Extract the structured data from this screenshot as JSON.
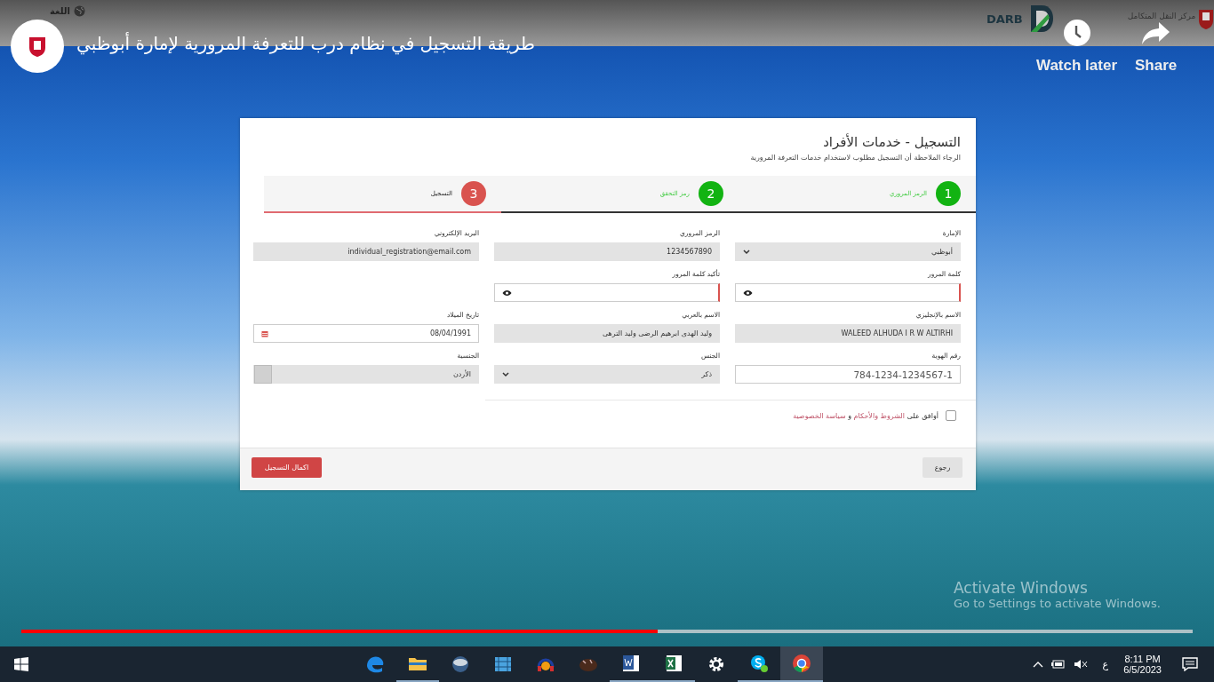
{
  "video": {
    "title": "طريقة التسجيل في نظام درب للتعرفة المرورية لإمارة أبوظبي",
    "language_label": "اللغة",
    "brand": {
      "latin": "DARB"
    },
    "emblem": {
      "arabic": "مركز النقل المتكامل"
    },
    "actions": [
      {
        "kind": "share",
        "label": "Share"
      },
      {
        "kind": "clock",
        "label": "Watch later"
      }
    ],
    "progress": {
      "level": 0.543
    },
    "os_notice": {
      "title": "Activate Windows",
      "subtitle": "Go to Settings to activate Windows."
    }
  },
  "form": {
    "title": "التسجيل - خدمات الأفراد",
    "subtitle": "الرجاء الملاحظة أن التسجيل مطلوب لاستخدام خدمات التعرفة المرورية",
    "steps": [
      {
        "number": "1",
        "label": "الرمز المروري",
        "completed": true,
        "selected": false
      },
      {
        "number": "2",
        "label": "رمز التحقق",
        "completed": true,
        "selected": false
      },
      {
        "number": "3",
        "label": "التسجيل",
        "completed": false,
        "selected": true
      }
    ],
    "fields": [
      {
        "label": "الإمارة",
        "kind": "select",
        "value": "أبوظبي",
        "disabled": true,
        "invalid": false
      },
      {
        "label": "الرمز المروري",
        "kind": "text",
        "value": "1234567890",
        "disabled": true,
        "invalid": false
      },
      {
        "label": "البريد الإلكتروني",
        "kind": "text",
        "value": "individual_registration@email.com",
        "disabled": true,
        "invalid": false
      },
      {
        "label": "كلمة المرور",
        "kind": "password",
        "disabled": false,
        "invalid": true
      },
      {
        "label": "تأكيد كلمة المرور",
        "kind": "password",
        "disabled": false,
        "invalid": true
      },
      {
        "kind": "blank"
      },
      {
        "label": "الاسم بالإنجليزي",
        "kind": "text",
        "value": "WALEED ALHUDA I R W ALTIRHI",
        "disabled": true,
        "invalid": false
      },
      {
        "label": "الاسم بالعربي",
        "kind": "text",
        "value": "وليد الهدى ابرهيم الرضى وليد الترهى",
        "disabled": true,
        "invalid": false
      },
      {
        "label": "تاريخ الميلاد",
        "kind": "date",
        "value": "08/04/1991",
        "disabled": false,
        "invalid": false
      },
      {
        "label": "رقم الهوية",
        "kind": "text",
        "value": "784-1234-1234567-1",
        "disabled": false,
        "invalid": false,
        "large": true
      },
      {
        "label": "الجنس",
        "kind": "select",
        "value": "ذكر",
        "disabled": true,
        "invalid": false
      },
      {
        "label": "الجنسية",
        "kind": "combo",
        "value": "الأردن",
        "disabled": true,
        "invalid": false
      }
    ],
    "agreement": {
      "checked": false,
      "prefix": "أوافق على",
      "terms_link": "الشروط والأحكام",
      "conjunction": "و",
      "privacy_link": "سياسة الخصوصية"
    },
    "buttons": [
      {
        "kind": "secondary",
        "label": "رجوع"
      },
      {
        "kind": "primary",
        "label": "اكمال التسجيل"
      }
    ]
  },
  "taskbar": {
    "apps": [
      {
        "kind": "edge",
        "running": false,
        "selected": false
      },
      {
        "kind": "folder",
        "running": true,
        "selected": false
      },
      {
        "kind": "globe",
        "running": false,
        "selected": false
      },
      {
        "kind": "film",
        "running": false,
        "selected": false
      },
      {
        "kind": "headphones",
        "running": false,
        "selected": false
      },
      {
        "kind": "creature",
        "running": false,
        "selected": false
      },
      {
        "kind": "word",
        "running": true,
        "selected": false
      },
      {
        "kind": "excel",
        "running": true,
        "selected": false
      },
      {
        "kind": "gear",
        "running": false,
        "selected": false
      },
      {
        "kind": "skype",
        "running": true,
        "selected": false
      },
      {
        "kind": "chrome",
        "running": true,
        "selected": true
      }
    ],
    "input_language": "ع",
    "time": "8:11 PM",
    "date": "6/5/2023"
  }
}
